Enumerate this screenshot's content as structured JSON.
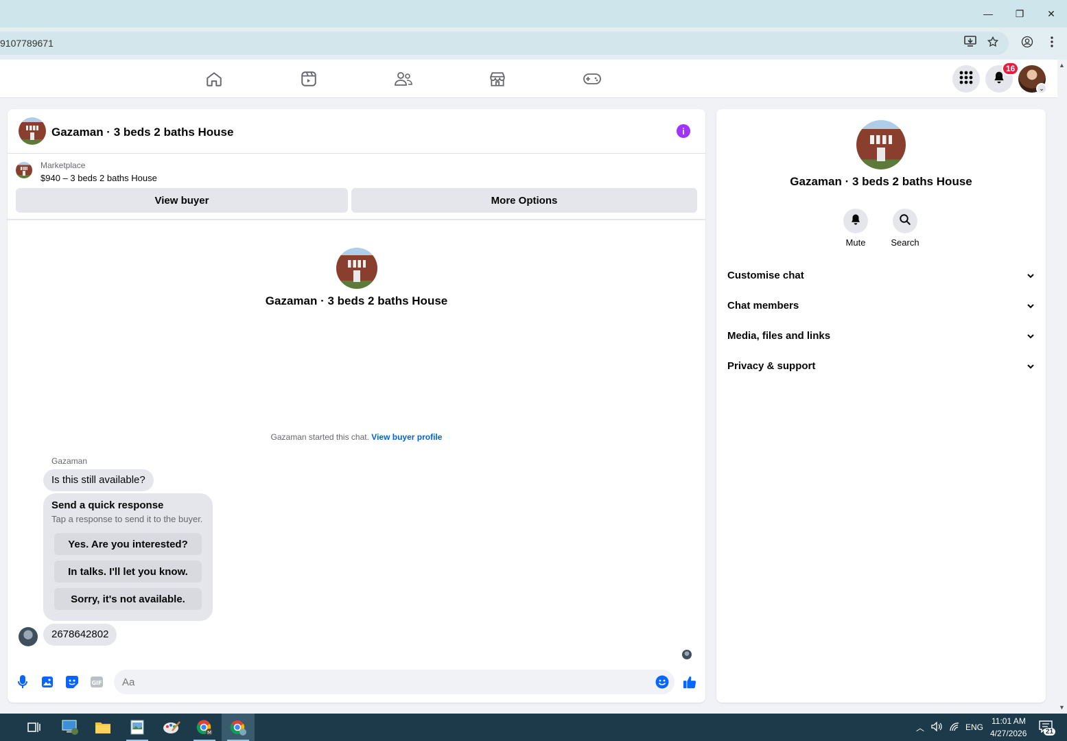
{
  "browser": {
    "url_partial": "9107789671",
    "window_controls": {
      "minimize": "—",
      "restore": "❐",
      "close": "✕"
    }
  },
  "fbnav": {
    "nav_icons": [
      "home-icon",
      "video-icon",
      "friends-icon",
      "marketplace-icon",
      "gaming-icon"
    ],
    "notification_count": "16"
  },
  "chat": {
    "title": "Gazaman · 3 beds 2 baths House",
    "marketplace_label": "Marketplace",
    "listing": "$940 – 3 beds 2 baths House",
    "view_buyer_label": "View buyer",
    "more_options_label": "More Options",
    "center_name": "Gazaman · 3 beds 2 baths House",
    "started_text": "Gazaman started this chat.",
    "view_buyer_profile": "View buyer profile",
    "sender_name": "Gazaman",
    "message_1": "Is this still available?",
    "quick_response": {
      "title": "Send a quick response",
      "subtitle": "Tap a response to send it to the buyer.",
      "options": [
        "Yes. Are you interested?",
        "In talks. I'll let you know.",
        "Sorry, it's not available."
      ]
    },
    "message_2": "2678642802",
    "composer_placeholder": "Aa",
    "composer_icons": [
      "microphone-icon",
      "photo-icon",
      "sticker-icon",
      "gif-icon",
      "emoji-icon",
      "thumbs-up-icon"
    ]
  },
  "info_panel": {
    "name": "Gazaman · 3 beds 2 baths House",
    "actions": [
      {
        "label": "Mute",
        "icon": "bell-icon"
      },
      {
        "label": "Search",
        "icon": "search-icon"
      }
    ],
    "sections": [
      "Customise chat",
      "Chat members",
      "Media, files and links",
      "Privacy & support"
    ]
  },
  "taskbar": {
    "lang": "ENG",
    "time": "11:01 AM",
    "date": "4/27/2026",
    "notification_count": "21"
  },
  "colors": {
    "accent": "#0866ff",
    "info": "#a033ff",
    "badge": "#e41e3f"
  }
}
